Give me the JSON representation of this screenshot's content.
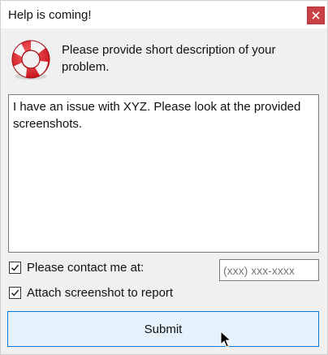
{
  "window": {
    "title": "Help is coming!",
    "close_icon": "close-icon",
    "accent_close": "#c94147"
  },
  "header": {
    "icon": "lifebuoy-icon",
    "prompt": "Please provide short description of your problem."
  },
  "description": {
    "value": "I have an issue with XYZ. Please look at the provided screenshots."
  },
  "contact": {
    "checked": true,
    "label": "Please contact me at:",
    "phone_placeholder": "(xxx) xxx-xxxx"
  },
  "attach": {
    "checked": true,
    "label": "Attach screenshot to report"
  },
  "submit": {
    "label": "Submit",
    "accent": "#0078d7"
  }
}
